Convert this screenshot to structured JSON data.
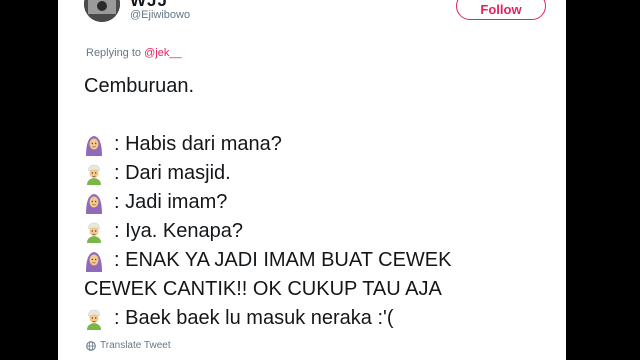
{
  "header": {
    "display_name": "WJJ",
    "handle": "@Ejiwibowo",
    "follow_label": "Follow"
  },
  "replying": {
    "prefix": "Replying to",
    "mention": "@jek__"
  },
  "tweet": {
    "title": "Cemburuan.",
    "lines": [
      {
        "speaker": "woman-headscarf-icon",
        "text": ": Habis dari mana?"
      },
      {
        "speaker": "man-turban-icon",
        "text": ": Dari masjid."
      },
      {
        "speaker": "woman-headscarf-icon",
        "text": ": Jadi imam?"
      },
      {
        "speaker": "man-turban-icon",
        "text": ": Iya. Kenapa?"
      },
      {
        "speaker": "woman-headscarf-icon",
        "text": ": ENAK YA JADI IMAM BUAT CEWEK"
      },
      {
        "speaker": "",
        "text": "CEWEK CANTIK!! OK CUKUP TAU AJA"
      },
      {
        "speaker": "man-turban-icon",
        "text": ": Baek baek lu masuk neraka :'("
      }
    ]
  },
  "footer": {
    "translate_label": "Translate Tweet"
  },
  "colors": {
    "accent": "#e0245e",
    "text": "#14171a",
    "secondary": "#657786",
    "background": "#000000",
    "woman_scarf": "#8e6ab8",
    "man_turban": "#e8e8e0"
  }
}
